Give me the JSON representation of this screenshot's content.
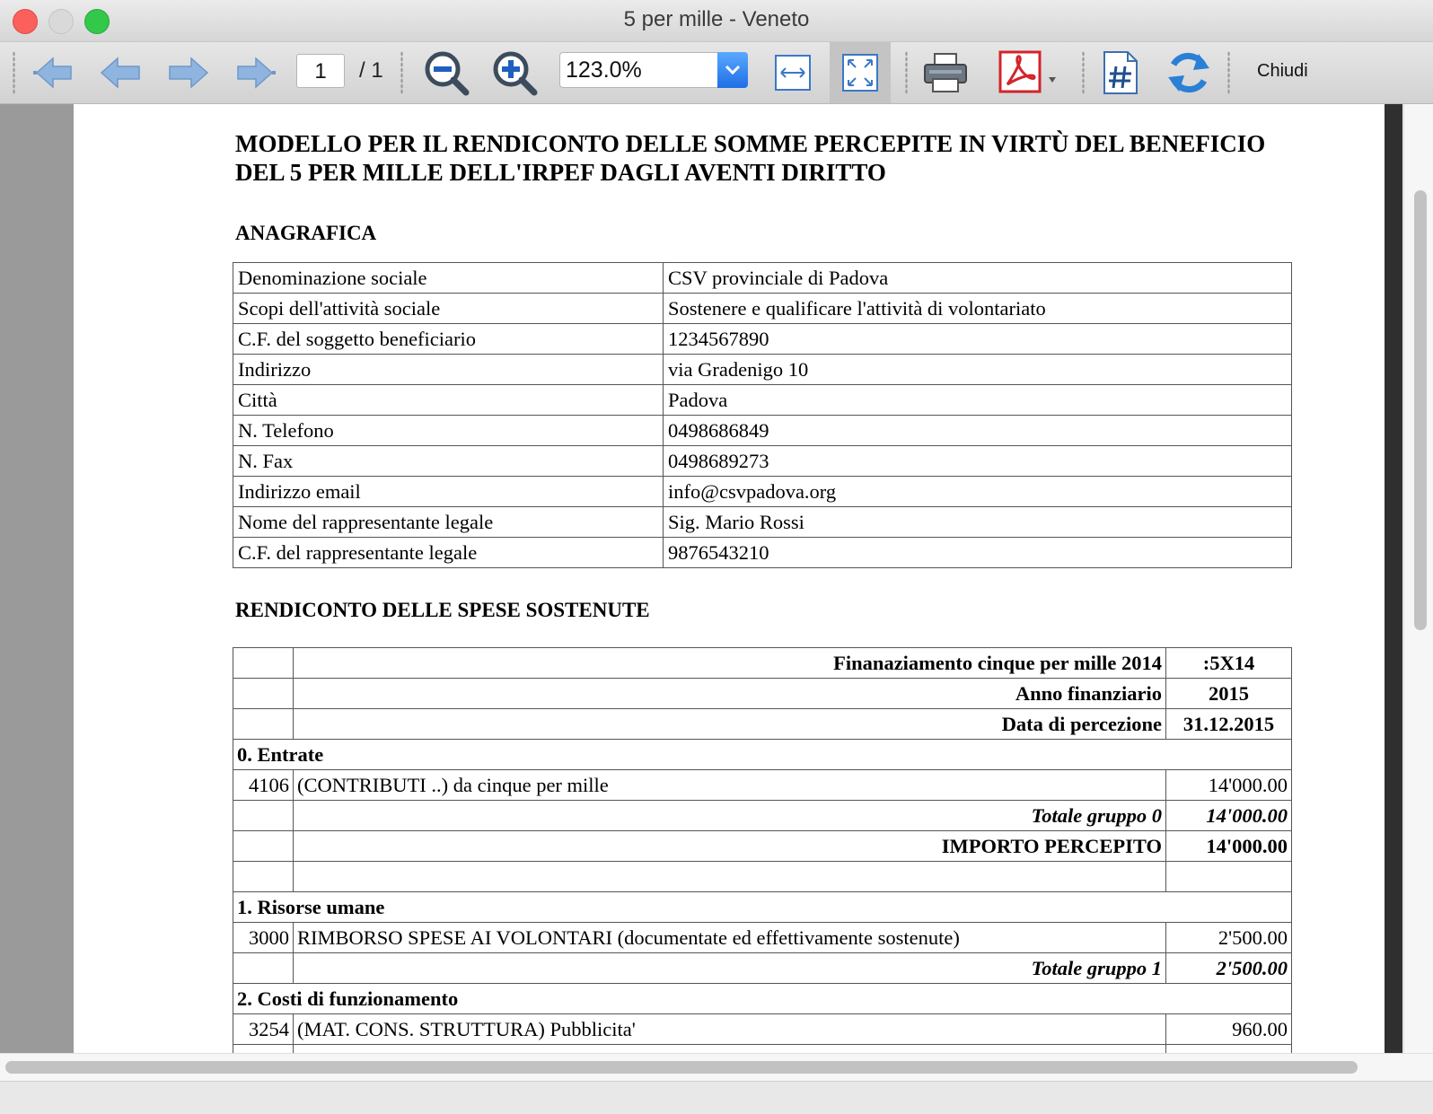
{
  "window": {
    "title": "5 per mille - Veneto"
  },
  "toolbar": {
    "page_current": "1",
    "page_total": "/ 1",
    "zoom": "123.0%",
    "close_label": "Chiudi",
    "icons": [
      "first-page-icon",
      "previous-page-icon",
      "next-page-icon",
      "last-page-icon",
      "zoom-out-icon",
      "zoom-in-icon",
      "fit-width-icon",
      "fit-page-icon",
      "print-icon",
      "pdf-export-icon",
      "page-number-icon",
      "refresh-icon"
    ]
  },
  "document": {
    "title": "MODELLO PER IL RENDICONTO DELLE SOMME PERCEPITE IN VIRTÙ DEL BENEFICIO DEL 5 PER MILLE DELL'IRPEF DAGLI AVENTI DIRITTO",
    "anagrafica_heading": "ANAGRAFICA",
    "anagrafica": [
      {
        "label": "Denominazione sociale",
        "value": "CSV provinciale di Padova"
      },
      {
        "label": "Scopi dell'attività sociale",
        "value": "Sostenere e qualificare l'attività di volontariato"
      },
      {
        "label": "C.F. del soggetto beneficiario",
        "value": "1234567890"
      },
      {
        "label": "Indirizzo",
        "value": "via Gradenigo 10"
      },
      {
        "label": "Città",
        "value": "Padova"
      },
      {
        "label": "N. Telefono",
        "value": "0498686849"
      },
      {
        "label": "N. Fax",
        "value": "0498689273"
      },
      {
        "label": "Indirizzo email",
        "value": "info@csvpadova.org"
      },
      {
        "label": "Nome del rappresentante legale",
        "value": "Sig. Mario Rossi"
      },
      {
        "label": "C.F. del rappresentante legale",
        "value": "9876543210"
      }
    ],
    "rendiconto_heading": "RENDICONTO DELLE SPESE SOSTENUTE",
    "rendiconto": {
      "finanziamento_label": "Finanaziamento cinque per mille 2014",
      "finanziamento_value": ":5X14",
      "anno_label": "Anno finanziario",
      "anno_value": "2015",
      "data_label": "Data di percezione",
      "data_value": "31.12.2015",
      "group0_title": "0. Entrate",
      "group0_code": "4106",
      "group0_desc": "(CONTRIBUTI ..) da cinque per mille",
      "group0_amount": "14'000.00",
      "group0_total_label": "Totale gruppo 0",
      "group0_total": "14'000.00",
      "importo_label": "IMPORTO PERCEPITO",
      "importo_value": "14'000.00",
      "group1_title": "1. Risorse umane",
      "group1_code": "3000",
      "group1_desc": "RIMBORSO SPESE AI VOLONTARI (documentate ed effettivamente sostenute)",
      "group1_amount": "2'500.00",
      "group1_total_label": "Totale gruppo 1",
      "group1_total": "2'500.00",
      "group2_title": "2. Costi di funzionamento",
      "group2_code": "3254",
      "group2_desc": "(MAT. CONS. STRUTTURA) Pubblicita'",
      "group2_amount": "960.00"
    }
  }
}
